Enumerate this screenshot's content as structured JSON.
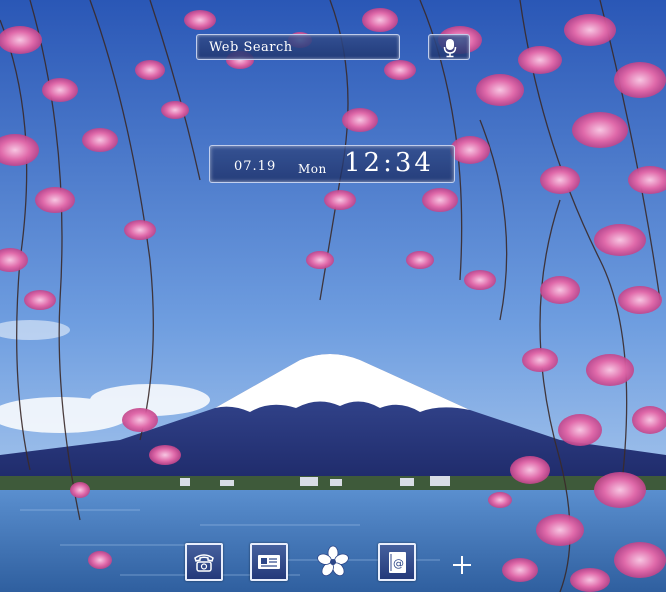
{
  "search": {
    "label": "Web Search",
    "mic_icon": "microphone-icon"
  },
  "clock": {
    "date": "07.19",
    "day": "Mon",
    "time": "12:34"
  },
  "dock": [
    {
      "name": "phone-icon"
    },
    {
      "name": "contacts-icon"
    },
    {
      "name": "sakura-flower-icon"
    },
    {
      "name": "email-icon"
    },
    {
      "name": "plus-icon"
    }
  ],
  "colors": {
    "sky_top": "#2e5dbb",
    "sky_bottom": "#b9d4f0",
    "lake": "#3d74b8",
    "blossom": "#d9599e",
    "widget_bg": "#2c4688"
  }
}
